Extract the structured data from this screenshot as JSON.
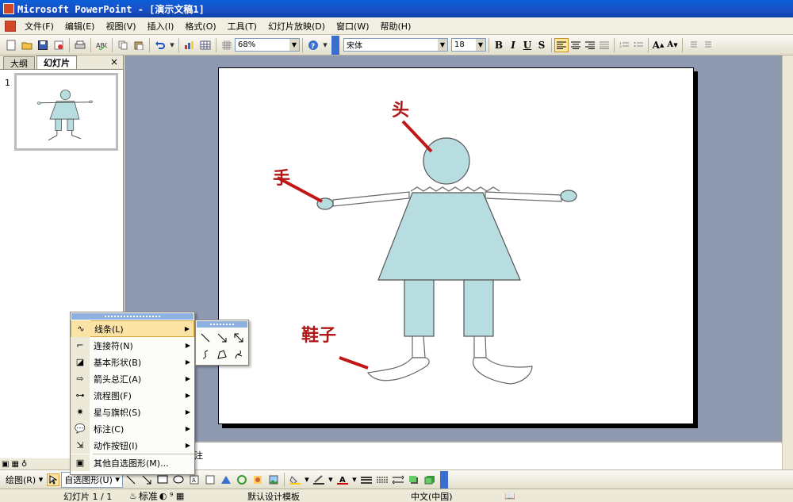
{
  "window": {
    "title": "Microsoft PowerPoint - [演示文稿1]"
  },
  "menu": [
    "文件(F)",
    "编辑(E)",
    "视图(V)",
    "插入(I)",
    "格式(O)",
    "工具(T)",
    "幻灯片放映(D)",
    "窗口(W)",
    "帮助(H)"
  ],
  "toolbar": {
    "zoom": "68%",
    "font": "宋体",
    "font_size": "18",
    "bold": "B",
    "italic": "I",
    "underline": "U",
    "shadow": "S"
  },
  "left_panel": {
    "tabs": [
      "大纲",
      "幻灯片"
    ],
    "active_tab": "幻灯片",
    "close": "×",
    "slide_number": "1"
  },
  "slide": {
    "labels": {
      "head": "头",
      "hand": "手",
      "shoes": "鞋子"
    },
    "colors": {
      "body_fill": "#b7dde0",
      "label_red": "#b01818"
    }
  },
  "notes": {
    "placeholder": "注"
  },
  "autoshape_menu": {
    "items": [
      {
        "label": "线条(L)",
        "icon": "lines-icon",
        "submenu": true,
        "highlighted": true
      },
      {
        "label": "连接符(N)",
        "icon": "connector-icon",
        "submenu": true
      },
      {
        "label": "基本形状(B)",
        "icon": "basic-shapes-icon",
        "submenu": true
      },
      {
        "label": "箭头总汇(A)",
        "icon": "block-arrows-icon",
        "submenu": true
      },
      {
        "label": "流程图(F)",
        "icon": "flowchart-icon",
        "submenu": true
      },
      {
        "label": "星与旗帜(S)",
        "icon": "stars-banners-icon",
        "submenu": true
      },
      {
        "label": "标注(C)",
        "icon": "callouts-icon",
        "submenu": true
      },
      {
        "label": "动作按钮(I)",
        "icon": "action-buttons-icon",
        "submenu": true
      }
    ],
    "more": "其他自选图形(M)..."
  },
  "drawbar": {
    "draw": "绘图(R)",
    "autoshapes": "自选图形(U)"
  },
  "status": {
    "slide": "幻灯片 1 / 1",
    "design": "标准",
    "template": "默认设计模板",
    "language": "中文(中国)"
  }
}
